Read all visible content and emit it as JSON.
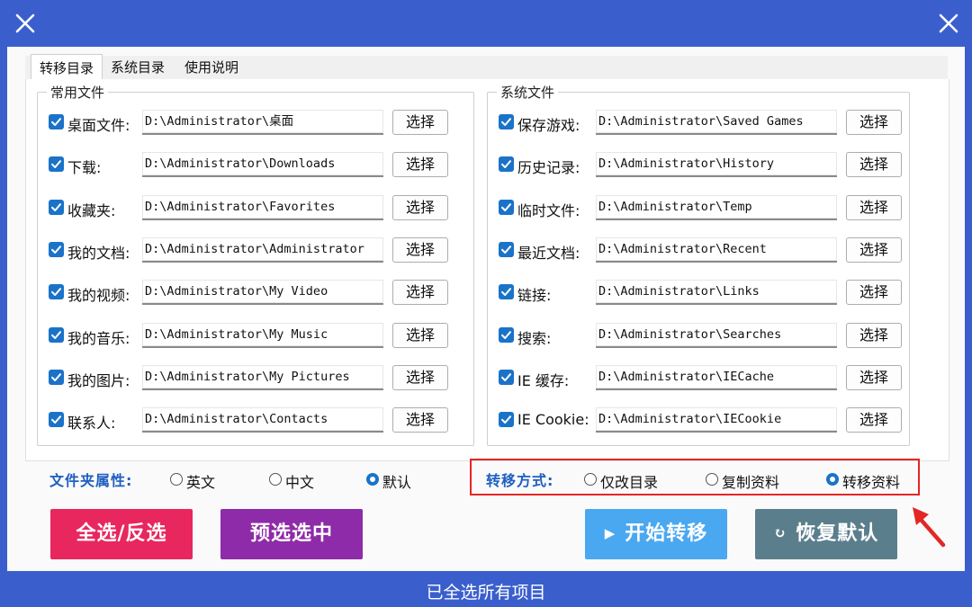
{
  "window": {
    "close_left_icon": "close-icon",
    "close_right_icon": "close-icon"
  },
  "tabs": [
    {
      "label": "转移目录",
      "active": true
    },
    {
      "label": "系统目录",
      "active": false
    },
    {
      "label": "使用说明",
      "active": false
    }
  ],
  "common_files": {
    "title": "常用文件",
    "rows": [
      {
        "label": "桌面文件:",
        "path": "D:\\Administrator\\桌面",
        "button": "选择",
        "checked": true
      },
      {
        "label": "下载:",
        "path": "D:\\Administrator\\Downloads",
        "button": "选择",
        "checked": true
      },
      {
        "label": "收藏夹:",
        "path": "D:\\Administrator\\Favorites",
        "button": "选择",
        "checked": true
      },
      {
        "label": "我的文档:",
        "path": "D:\\Administrator\\Administrator",
        "button": "选择",
        "checked": true
      },
      {
        "label": "我的视频:",
        "path": "D:\\Administrator\\My Video",
        "button": "选择",
        "checked": true
      },
      {
        "label": "我的音乐:",
        "path": "D:\\Administrator\\My Music",
        "button": "选择",
        "checked": true
      },
      {
        "label": "我的图片:",
        "path": "D:\\Administrator\\My Pictures",
        "button": "选择",
        "checked": true
      },
      {
        "label": "联系人:",
        "path": "D:\\Administrator\\Contacts",
        "button": "选择",
        "checked": true
      }
    ]
  },
  "system_files": {
    "title": "系统文件",
    "rows": [
      {
        "label": "保存游戏:",
        "path": "D:\\Administrator\\Saved Games",
        "button": "选择",
        "checked": true
      },
      {
        "label": "历史记录:",
        "path": "D:\\Administrator\\History",
        "button": "选择",
        "checked": true
      },
      {
        "label": "临时文件:",
        "path": "D:\\Administrator\\Temp",
        "button": "选择",
        "checked": true
      },
      {
        "label": "最近文档:",
        "path": "D:\\Administrator\\Recent",
        "button": "选择",
        "checked": true
      },
      {
        "label": "链接:",
        "path": "D:\\Administrator\\Links",
        "button": "选择",
        "checked": true
      },
      {
        "label": "搜索:",
        "path": "D:\\Administrator\\Searches",
        "button": "选择",
        "checked": true
      },
      {
        "label": "IE 缓存:",
        "path": "D:\\Administrator\\IECache",
        "button": "选择",
        "checked": true
      },
      {
        "label": "IE Cookie:",
        "path": "D:\\Administrator\\IECookie",
        "button": "选择",
        "checked": true
      }
    ]
  },
  "folder_attr": {
    "label": "文件夹属性:",
    "options": [
      {
        "label": "英文",
        "selected": false
      },
      {
        "label": "中文",
        "selected": false
      },
      {
        "label": "默认",
        "selected": true
      }
    ]
  },
  "transfer_mode": {
    "label": "转移方式:",
    "options": [
      {
        "label": "仅改目录",
        "selected": false
      },
      {
        "label": "复制资料",
        "selected": false
      },
      {
        "label": "转移资料",
        "selected": true
      }
    ]
  },
  "buttons": {
    "select_all": {
      "label": "全选/反选",
      "color": "#e8275f"
    },
    "preselect": {
      "label": "预选选中",
      "color": "#8e2ba8"
    },
    "start": {
      "label": "开始转移",
      "icon": "play-icon",
      "color": "#4aa8f0"
    },
    "restore": {
      "label": "恢复默认",
      "icon": "refresh-icon",
      "color": "#5b7e8d"
    }
  },
  "status": "已全选所有项目",
  "colors": {
    "titlebar": "#3a5fcd",
    "accent": "#1a73c8",
    "highlight_box": "#e32626"
  }
}
